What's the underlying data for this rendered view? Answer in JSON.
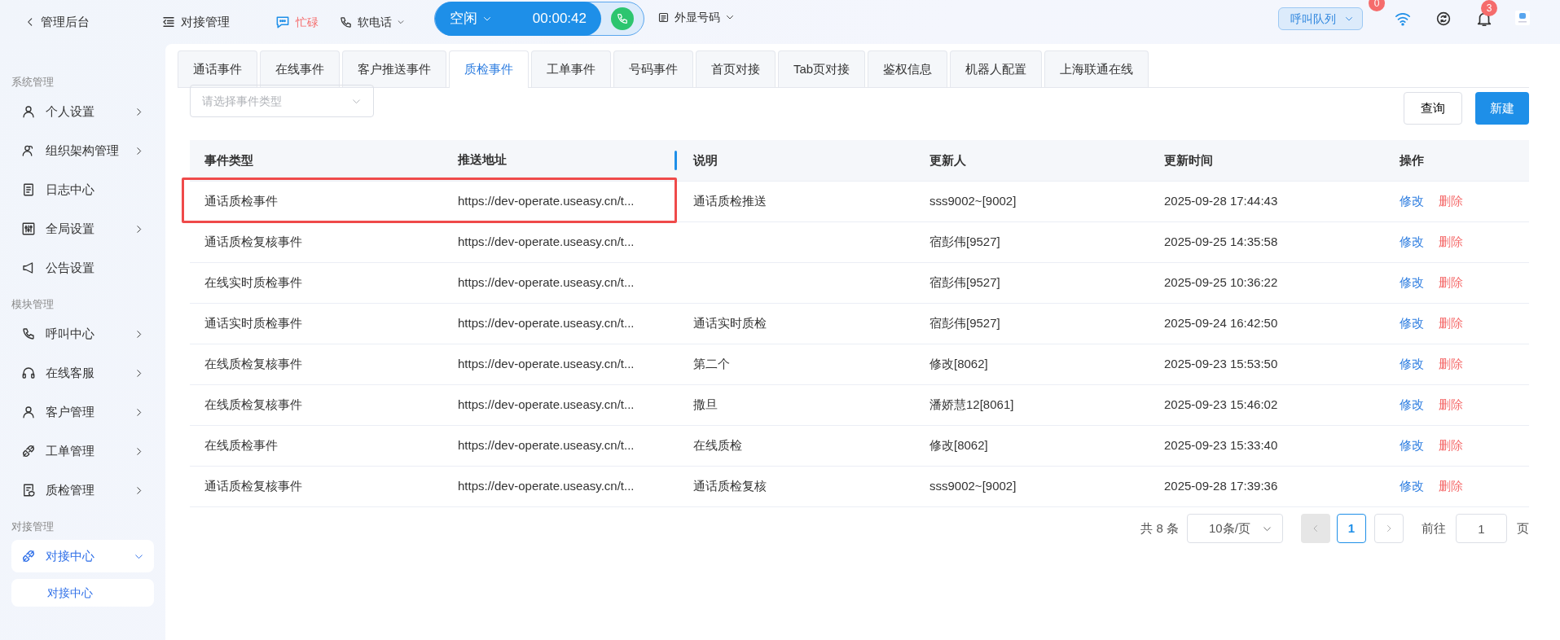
{
  "topbar": {
    "back": "管理后台",
    "module": "对接管理",
    "status": "忙碌",
    "softphone": "软电话",
    "call_state": "空闲",
    "timer": "00:00:42",
    "caller_id": "外显号码",
    "queue": "呼叫队列",
    "queue_badge": "0",
    "bell_badge": "3"
  },
  "sidebar": {
    "sections": [
      {
        "heading": "系统管理",
        "items": [
          {
            "label": "个人设置",
            "expanded": false,
            "selected": false
          },
          {
            "label": "组织架构管理",
            "expanded": false,
            "selected": false
          },
          {
            "label": "日志中心",
            "selected": false
          },
          {
            "label": "全局设置",
            "expanded": false,
            "selected": false
          },
          {
            "label": "公告设置",
            "selected": false
          }
        ]
      },
      {
        "heading": "模块管理",
        "items": [
          {
            "label": "呼叫中心",
            "expanded": false,
            "selected": false
          },
          {
            "label": "在线客服",
            "expanded": false,
            "selected": false
          },
          {
            "label": "客户管理",
            "expanded": false,
            "selected": false
          },
          {
            "label": "工单管理",
            "expanded": false,
            "selected": false
          },
          {
            "label": "质检管理",
            "expanded": false,
            "selected": false
          }
        ]
      },
      {
        "heading": "对接管理",
        "items": [
          {
            "label": "对接中心",
            "expanded": true,
            "selected": true,
            "children": [
              {
                "label": "对接中心",
                "selected": true
              }
            ]
          }
        ]
      }
    ]
  },
  "tabs": [
    {
      "label": "通话事件",
      "selected": false
    },
    {
      "label": "在线事件",
      "selected": false
    },
    {
      "label": "客户推送事件",
      "selected": false
    },
    {
      "label": "质检事件",
      "selected": true
    },
    {
      "label": "工单事件",
      "selected": false
    },
    {
      "label": "号码事件",
      "selected": false
    },
    {
      "label": "首页对接",
      "selected": false
    },
    {
      "label": "Tab页对接",
      "selected": false
    },
    {
      "label": "鉴权信息",
      "selected": false
    },
    {
      "label": "机器人配置",
      "selected": false
    },
    {
      "label": "上海联通在线",
      "selected": false
    }
  ],
  "filter": {
    "placeholder": "请选择事件类型"
  },
  "buttons": {
    "query": "查询",
    "create": "新建"
  },
  "table": {
    "columns": [
      "事件类型",
      "推送地址",
      "说明",
      "更新人",
      "更新时间",
      "操作"
    ],
    "rows": [
      {
        "type": "通话质检事件",
        "url": "https://dev-operate.useasy.cn/t...",
        "note": "通话质检推送",
        "updater": "sss9002~[9002]",
        "time": "2025-09-28 17:44:43",
        "edit": "修改",
        "delete": "删除",
        "highlighted": true
      },
      {
        "type": "通话质检复核事件",
        "url": "https://dev-operate.useasy.cn/t...",
        "updater": "宿彭伟[9527]",
        "time": "2025-09-25 14:35:58",
        "edit": "修改",
        "delete": "删除",
        "highlighted": false
      },
      {
        "type": "在线实时质检事件",
        "url": "https://dev-operate.useasy.cn/t...",
        "updater": "宿彭伟[9527]",
        "time": "2025-09-25 10:36:22",
        "edit": "修改",
        "delete": "删除",
        "highlighted": false
      },
      {
        "type": "通话实时质检事件",
        "url": "https://dev-operate.useasy.cn/t...",
        "note": "通话实时质检",
        "updater": "宿彭伟[9527]",
        "time": "2025-09-24 16:42:50",
        "edit": "修改",
        "delete": "删除",
        "highlighted": false
      },
      {
        "type": "在线质检复核事件",
        "url": "https://dev-operate.useasy.cn/t...",
        "note": "第二个",
        "updater": "修改[8062]",
        "time": "2025-09-23 15:53:50",
        "edit": "修改",
        "delete": "删除",
        "highlighted": false
      },
      {
        "type": "在线质检复核事件",
        "url": "https://dev-operate.useasy.cn/t...",
        "note": "撒旦",
        "updater": "潘娇慧12[8061]",
        "time": "2025-09-23 15:46:02",
        "edit": "修改",
        "delete": "删除",
        "highlighted": false
      },
      {
        "type": "在线质检事件",
        "url": "https://dev-operate.useasy.cn/t...",
        "note": "在线质检",
        "updater": "修改[8062]",
        "time": "2025-09-23 15:33:40",
        "edit": "修改",
        "delete": "删除",
        "highlighted": false
      },
      {
        "type": "通话质检复核事件",
        "url": "https://dev-operate.useasy.cn/t...",
        "note": "通话质检复核",
        "updater": "sss9002~[9002]",
        "time": "2025-09-28 17:39:36",
        "edit": "修改",
        "delete": "删除",
        "highlighted": false
      }
    ]
  },
  "pagination": {
    "total": "共 8 条",
    "page_size": "10条/页",
    "pages": [
      {
        "label": "1",
        "selected": true
      }
    ],
    "goto_label": "前往",
    "goto_value": "1",
    "goto_suffix": "页"
  }
}
